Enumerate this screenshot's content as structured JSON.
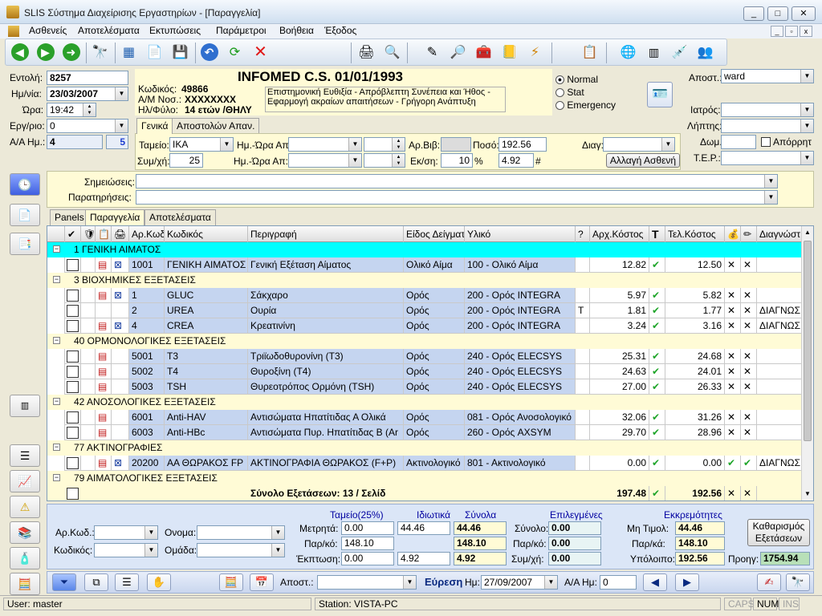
{
  "window": {
    "title": "SLIS Σύστημα Διαχείρισης Εργαστηρίων - [Παραγγελία]"
  },
  "menu": {
    "items": [
      "Ασθενείς",
      "Αποτελέσματα",
      "Εκτυπώσεις",
      "Παράμετροι",
      "Βοήθεια",
      "Έξοδος"
    ]
  },
  "order": {
    "entolh_label": "Εντολή:",
    "entolh": "8257",
    "date_label": "Ημ/νία:",
    "date": "23/03/2007",
    "time_label": "Ώρα:",
    "time": "19:42",
    "lab_label": "Εργ/ριο:",
    "lab": "0",
    "aa_label": "Α/Α Ημ.:",
    "aa": "4",
    "aa_count": "5"
  },
  "patient": {
    "code_label": "Κωδικός:",
    "code": "49866",
    "am_label": "Α/Μ Νοσ.:",
    "am": "XXXXXXXX",
    "age_label": "Ηλ/Φύλο:",
    "age": "14 ετών /ΘΗΛΥ",
    "name": "INFOMED C.S. 01/01/1993",
    "notes": [
      "Επιστημονική Ευθιξία - Απρόβλεπτη Συνέπεια και Ήθος -",
      "Εφαρμογή ακραίων απαιτήσεων - Γρήγορη Ανάπτυξη"
    ]
  },
  "priority": {
    "options": [
      "Normal",
      "Stat",
      "Emergency"
    ],
    "selected": "Normal"
  },
  "right_fields": {
    "apost_label": "Αποστ.:",
    "apost": "ward",
    "iatros_label": "Ιατρός:",
    "lhpths_label": "Λήπτης:",
    "dwm_label": "Δωμ.:",
    "aporrhto_label": "Απόρρητ",
    "tep_label": "Τ.Ε.Ρ.:"
  },
  "info_tabs": [
    "Γενικά",
    "Αποστολών Απαν."
  ],
  "general": {
    "tameio_label": "Ταμείο:",
    "tameio": "ΙΚΑ",
    "hmwra_ap_label": "Ημ.-Ώρα Απ:",
    "hmwra_ap2_label": "Ημ.-Ώρα Απ:",
    "arvib_label": "Αρ.Βιβ:",
    "poso_label": "Ποσό:",
    "poso": "192.56",
    "diag_label": "Διαγ:",
    "symxh_label": "Συμ/χή:",
    "symxh": "25",
    "ekpt_label": "Εκ/ση:",
    "ekpt": "10",
    "ekpt_unit": "%",
    "ekpt_amount": "4.92",
    "hash": "#",
    "change_patient_button": "Αλλαγή Ασθενή"
  },
  "notes_area": {
    "simeioseis_label": "Σημειώσεις:",
    "parathrhseis_label": "Παρατηρήσεις:"
  },
  "grid_tabs": [
    "Panels",
    "Παραγγελία",
    "Αποτελέσματα"
  ],
  "grid": {
    "columns": [
      "✔",
      "",
      "",
      "",
      "Αρ.Κωδ",
      "Κωδικός",
      "Περιγραφή",
      "Είδος Δείγματ",
      "Υλικό",
      "?",
      "Αρχ.Κόστος",
      "T",
      "Τελ.Κόστος",
      "",
      "",
      "Διαγνώστ"
    ],
    "rows": [
      {
        "type": "group",
        "label": "1 ΓΕΝΙΚΗ ΑΙΜΑΤΟΣ",
        "selected": true
      },
      {
        "type": "data",
        "num": "1001",
        "code": "ΓΕΝΙΚΗ ΑΙΜΑΤΟΣ",
        "desc": "Γενική Εξέταση Αίματος",
        "sample": "Ολικό Αίμα",
        "material": "100 - Ολικό Αίμα",
        "q": "",
        "cost": "12.82",
        "final": "12.50",
        "f1": "x",
        "f2": "x",
        "diag": "",
        "icons": 2
      },
      {
        "type": "group",
        "label": "3 ΒΙΟΧΗΜΙΚΕΣ ΕΞΕΤΑΣΕΙΣ"
      },
      {
        "type": "data",
        "num": "1",
        "code": "GLUC",
        "desc": "Σάκχαρο",
        "sample": "Ορός",
        "material": "200 - Ορός INTEGRA",
        "q": "",
        "cost": "5.97",
        "final": "5.82",
        "f1": "x",
        "f2": "x",
        "diag": "",
        "icons": 2
      },
      {
        "type": "data",
        "num": "2",
        "code": "UREA",
        "desc": "Ουρία",
        "sample": "Ορός",
        "material": "200 - Ορός INTEGRA",
        "q": "T",
        "cost": "1.81",
        "final": "1.77",
        "f1": "x",
        "f2": "x",
        "diag": "ΔΙΑΓΝΩΣ",
        "icons": 0
      },
      {
        "type": "data",
        "num": "4",
        "code": "CREA",
        "desc": "Κρεατινίνη",
        "sample": "Ορός",
        "material": "200 - Ορός INTEGRA",
        "q": "",
        "cost": "3.24",
        "final": "3.16",
        "f1": "x",
        "f2": "x",
        "diag": "ΔΙΑΓΝΩΣ",
        "icons": 2
      },
      {
        "type": "group",
        "label": "40 ΟΡΜΟΝΟΛΟΓΙΚΕΣ ΕΞΕΤΑΣΕΙΣ"
      },
      {
        "type": "data",
        "num": "5001",
        "code": "T3",
        "desc": "Τριϊωδοθυρονίνη (T3)",
        "sample": "Ορός",
        "material": "240 - Ορός ELECSYS",
        "q": "",
        "cost": "25.31",
        "final": "24.68",
        "f1": "x",
        "f2": "x",
        "diag": "",
        "icons": 1
      },
      {
        "type": "data",
        "num": "5002",
        "code": "T4",
        "desc": "Θυροξίνη (T4)",
        "sample": "Ορός",
        "material": "240 - Ορός ELECSYS",
        "q": "",
        "cost": "24.63",
        "final": "24.01",
        "f1": "x",
        "f2": "x",
        "diag": "",
        "icons": 1
      },
      {
        "type": "data",
        "num": "5003",
        "code": "TSH",
        "desc": "Θυρεοτρόπος Ορμόνη (TSH)",
        "sample": "Ορός",
        "material": "240 - Ορός ELECSYS",
        "q": "",
        "cost": "27.00",
        "final": "26.33",
        "f1": "x",
        "f2": "x",
        "diag": "",
        "icons": 1
      },
      {
        "type": "group",
        "label": "42 ΑΝΟΣΟΛΟΓΙΚΕΣ ΕΞΕΤΑΣΕΙΣ"
      },
      {
        "type": "data",
        "num": "6001",
        "code": "Anti-HAV",
        "desc": "Αντισώματα Ηπατίτιδας Α Ολικά",
        "sample": "Ορός",
        "material": "081 - Ορός Ανοσολογικό",
        "q": "",
        "cost": "32.06",
        "final": "31.26",
        "f1": "x",
        "f2": "x",
        "diag": "",
        "icons": 1
      },
      {
        "type": "data",
        "num": "6003",
        "code": "Anti-HBc",
        "desc": "Αντισώματα Πυρ. Ηπατίτιδας Β (Ar",
        "sample": "Ορός",
        "material": "260 - Ορός AXSYM",
        "q": "",
        "cost": "29.70",
        "final": "28.96",
        "f1": "x",
        "f2": "x",
        "diag": "",
        "icons": 1
      },
      {
        "type": "group",
        "label": "77 ΑΚΤΙΝΟΓΡΑΦΙΕΣ"
      },
      {
        "type": "data",
        "num": "20200",
        "code": "ΑΑ ΘΩΡΑΚΟΣ FP",
        "desc": "ΑΚΤΙΝΟΓΡΑΦΙΑ ΘΩΡΑΚΟΣ (F+P)",
        "sample": "Ακτινολογικό",
        "material": "801 - Ακτινολογικό",
        "q": "",
        "cost": "0.00",
        "final": "0.00",
        "f1": "v",
        "f2": "v",
        "diag": "ΔΙΑΓΝΩΣ",
        "icons": 2
      },
      {
        "type": "group",
        "label": "79 ΑΙΜΑΤΟΛΟΓΙΚΕΣ ΕΞΕΤΑΣΕΙΣ"
      }
    ],
    "summary": {
      "label": "Σύνολο Εξετάσεων:  13 / Σελίδ",
      "cost": "197.48",
      "final": "192.56"
    }
  },
  "filters": {
    "arkwd_label": "Αρ.Κωδ.:",
    "kwdikos_label": "Κωδικός:",
    "onoma_label": "Ονομα:",
    "omada_label": "Ομάδα:"
  },
  "totals": {
    "tameio_header": "Ταμείο(25%)",
    "idiwtika_header": "Ιδιωτικά",
    "synola_header": "Σύνολα",
    "epilegmenes_header": "Επιλεγμένες",
    "ekkremothtes_header": "Εκκρεμότητες",
    "metrhta_label": "Μετρητά:",
    "metrhta": "0.00",
    "metrhta_idiwtika": "44.46",
    "metrhta_synola": "44.46",
    "parko_label": "Παρ/κό:",
    "parko": "148.10",
    "parko_synola": "148.10",
    "ekptwsh_label": "Έκπτωση:",
    "ekptwsh": "0.00",
    "ekptwsh_idiwtika": "4.92",
    "ekptwsh_synola": "4.92",
    "sel_synolo_label": "Σύνολο:",
    "sel_synolo": "0.00",
    "sel_parko_label": "Παρ/κό:",
    "sel_parko": "0.00",
    "sel_symxh_label": "Συμ/χή:",
    "sel_symxh": "0.00",
    "mh_timol_label": "Μη Τιμολ:",
    "mh_timol": "44.46",
    "ekk_parka_label": "Παρ/κά:",
    "ekk_parka": "148.10",
    "ypoloipo_label": "Υπόλοιπο:",
    "ypoloipo": "192.56",
    "clear_button": "Καθαρισμός Εξετάσεων",
    "prohg_label": "Προηγ:",
    "prohg": "1754.94"
  },
  "footer": {
    "apost_label": "Αποστ.:",
    "search_label": "Εύρεση",
    "hm_label": "Ημ:",
    "hm": "27/09/2007",
    "aa_label": "Α/Α Ημ:",
    "aa": "0"
  },
  "status": {
    "user": "User: master",
    "station": "Station: VISTA-PC",
    "caps": "CAPS",
    "num": "NUM",
    "ins": "INS"
  }
}
